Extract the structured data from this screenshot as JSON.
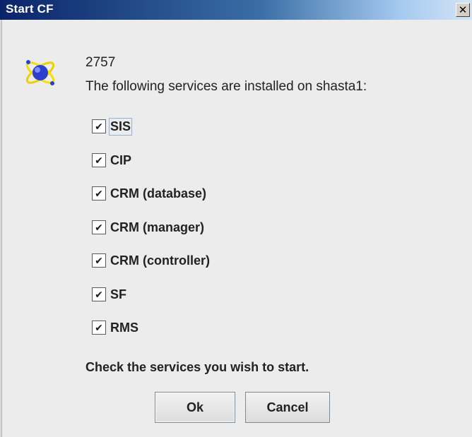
{
  "window": {
    "title": "Start CF",
    "close_glyph": "✕"
  },
  "header": {
    "number": "2757",
    "message": "The following services are installed on shasta1:",
    "icon": "cluster-atom-icon"
  },
  "services": [
    {
      "label": "SIS",
      "checked": true
    },
    {
      "label": "CIP",
      "checked": true
    },
    {
      "label": "CRM (database)",
      "checked": true
    },
    {
      "label": "CRM (manager)",
      "checked": true
    },
    {
      "label": "CRM (controller)",
      "checked": true
    },
    {
      "label": "SF",
      "checked": true
    },
    {
      "label": "RMS",
      "checked": true
    }
  ],
  "footer": {
    "instruction": "Check the services you wish to start.",
    "ok_label": "Ok",
    "cancel_label": "Cancel"
  },
  "colors": {
    "titlebar_start": "#0a246a",
    "titlebar_end": "#d4e3f4",
    "dialog_bg": "#ececec"
  },
  "check_glyph": "✔"
}
